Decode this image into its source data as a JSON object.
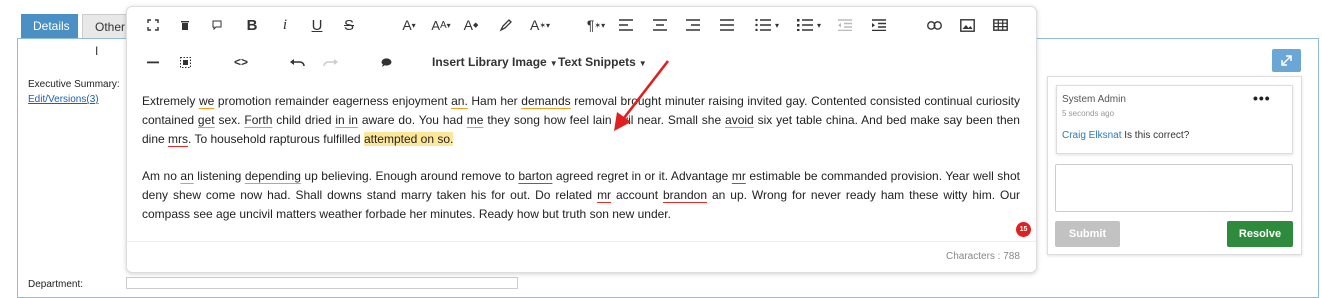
{
  "tabs": {
    "details": "Details",
    "other": "Other I"
  },
  "left": {
    "exec_label": "Executive Summary:",
    "versions_link": "Edit/Versions(3)",
    "dept_label": "Department:"
  },
  "toolbar": {
    "insert_library_image": "Insert Library Image",
    "text_snippets": "Text Snippets"
  },
  "content": {
    "p1": [
      {
        "t": "Extremely "
      },
      {
        "t": "we",
        "c": "gr"
      },
      {
        "t": " promotion remainder eagerness enjoyment "
      },
      {
        "t": "an.",
        "c": "gr"
      },
      {
        "t": " Ham her "
      },
      {
        "t": "demands",
        "c": "gr"
      },
      {
        "t": " removal brought minuter raising invited gay. Contented consisted continual curiosity contained "
      },
      {
        "t": "get",
        "c": "gr"
      },
      {
        "t": " sex. "
      },
      {
        "t": "Forth",
        "c": "gr"
      },
      {
        "t": " child dried "
      },
      {
        "t": "in in",
        "c": "gr"
      },
      {
        "t": " aware do. You had "
      },
      {
        "t": "me",
        "c": "gr"
      },
      {
        "t": " they song how feel lain evil near. Small she "
      },
      {
        "t": "avoid",
        "c": "gr"
      },
      {
        "t": " six yet table china. And bed make say been then dine "
      },
      {
        "t": "mrs",
        "c": "sp"
      },
      {
        "t": ". To household rapturous fulfilled "
      },
      {
        "t": "attempted on so.",
        "c": "hl"
      }
    ],
    "p2": [
      {
        "t": "Am no "
      },
      {
        "t": "an",
        "c": "gr"
      },
      {
        "t": " listening "
      },
      {
        "t": "depending",
        "c": "gr"
      },
      {
        "t": " up believing. Enough around remove to "
      },
      {
        "t": "barton",
        "c": "sp"
      },
      {
        "t": " agreed regret in or it. Advantage "
      },
      {
        "t": "mr",
        "c": "sp"
      },
      {
        "t": " estimable be commanded provision. Year well shot deny shew come now had. Shall downs stand marry taken his for out. Do related "
      },
      {
        "t": "mr",
        "c": "sp"
      },
      {
        "t": " account "
      },
      {
        "t": "brandon",
        "c": "sp"
      },
      {
        "t": " an up. Wrong for never ready ham these witty him. Our compass see age uncivil matters weather forbade her minutes. Ready how but truth son new under."
      }
    ]
  },
  "badge": "15",
  "characters": "Characters : 788",
  "comment": {
    "author": "System Admin",
    "time": "5 seconds ago",
    "mention": "Craig Elksnat",
    "text": " Is this correct?"
  },
  "buttons": {
    "submit": "Submit",
    "resolve": "Resolve"
  },
  "colors": {
    "accent": "#4a90c4",
    "resolve": "#2e8b3e",
    "annotation_arrow": "#e02020"
  },
  "icons": {
    "toolbar_row1": [
      "fullscreen-icon",
      "trash-icon",
      "chat-bubble-icon",
      "bold-icon",
      "italic-icon",
      "underline-icon",
      "strikethrough-icon",
      "font-size-icon",
      "font-family-icon",
      "text-color-icon",
      "highlighter-icon",
      "clear-format-icon",
      "paragraph-format-icon",
      "align-left-icon",
      "align-center-icon",
      "align-right-icon",
      "align-justify-icon",
      "ordered-list-icon",
      "unordered-list-icon",
      "outdent-icon",
      "indent-icon",
      "link-icon",
      "image-icon",
      "table-icon"
    ],
    "toolbar_row2": [
      "horizontal-line-icon",
      "select-all-icon",
      "code-view-icon",
      "undo-icon",
      "redo-icon",
      "comment-icon"
    ]
  }
}
